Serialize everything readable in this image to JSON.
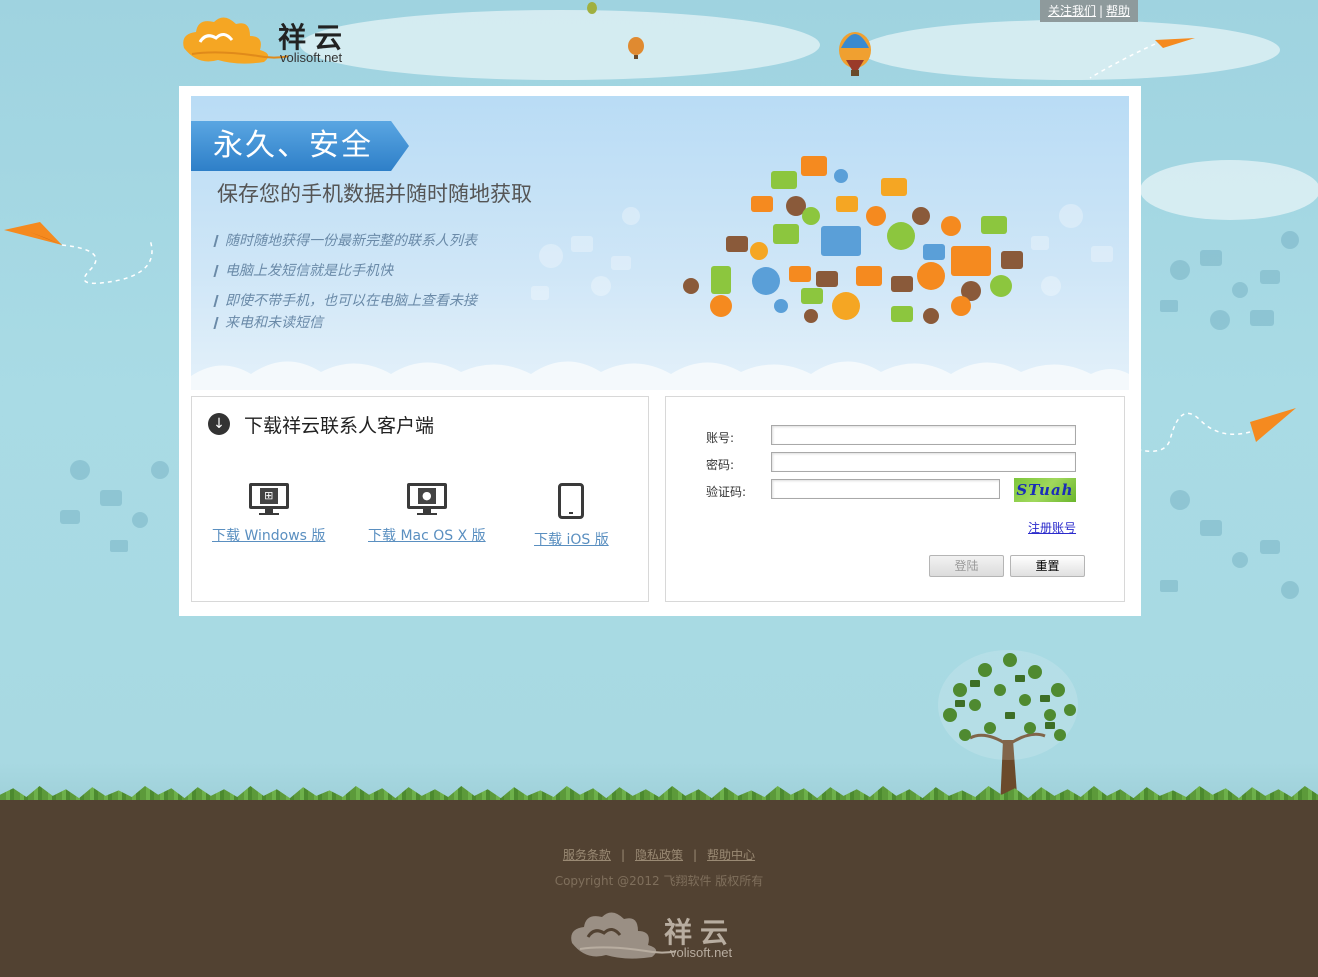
{
  "topbar": {
    "follow_label": "关注我们",
    "help_label": "帮助"
  },
  "logo": {
    "cn": "祥云",
    "en": "volisoft.net"
  },
  "banner": {
    "ribbon": "永久、安全",
    "headline": "保存您的手机数据并随时随地获取",
    "features": [
      "随时随地获得一份最新完整的联系人列表",
      "电脑上发短信就是比手机快",
      "即使不带手机，也可以在电脑上查看未接",
      "来电和未读短信"
    ]
  },
  "download": {
    "title": "下载祥云联系人客户端",
    "platforms": [
      {
        "label": "下载 Windows 版",
        "icon": "windows-monitor-icon"
      },
      {
        "label": "下载 Mac OS X 版",
        "icon": "apple-monitor-icon"
      },
      {
        "label": "下载 iOS 版",
        "icon": "phone-icon"
      }
    ]
  },
  "login": {
    "account_label": "账号:",
    "password_label": "密码:",
    "captcha_label": "验证码:",
    "account_value": "",
    "password_value": "",
    "captcha_value": "",
    "captcha_text": "STuah",
    "register_label": "注册账号",
    "login_label": "登陆",
    "reset_label": "重置"
  },
  "footer": {
    "links": [
      "服务条款",
      "隐私政策",
      "帮助中心"
    ],
    "copyright": "Copyright @2012 飞翔软件 版权所有",
    "logo_cn": "祥云",
    "logo_en": "volisoft.net"
  },
  "colors": {
    "sky": "#a9dbe5",
    "ground": "#524232",
    "accent_blue": "#2e7fc8",
    "link_blue": "#5a8fc0",
    "paper_plane": "#f58a1f"
  }
}
